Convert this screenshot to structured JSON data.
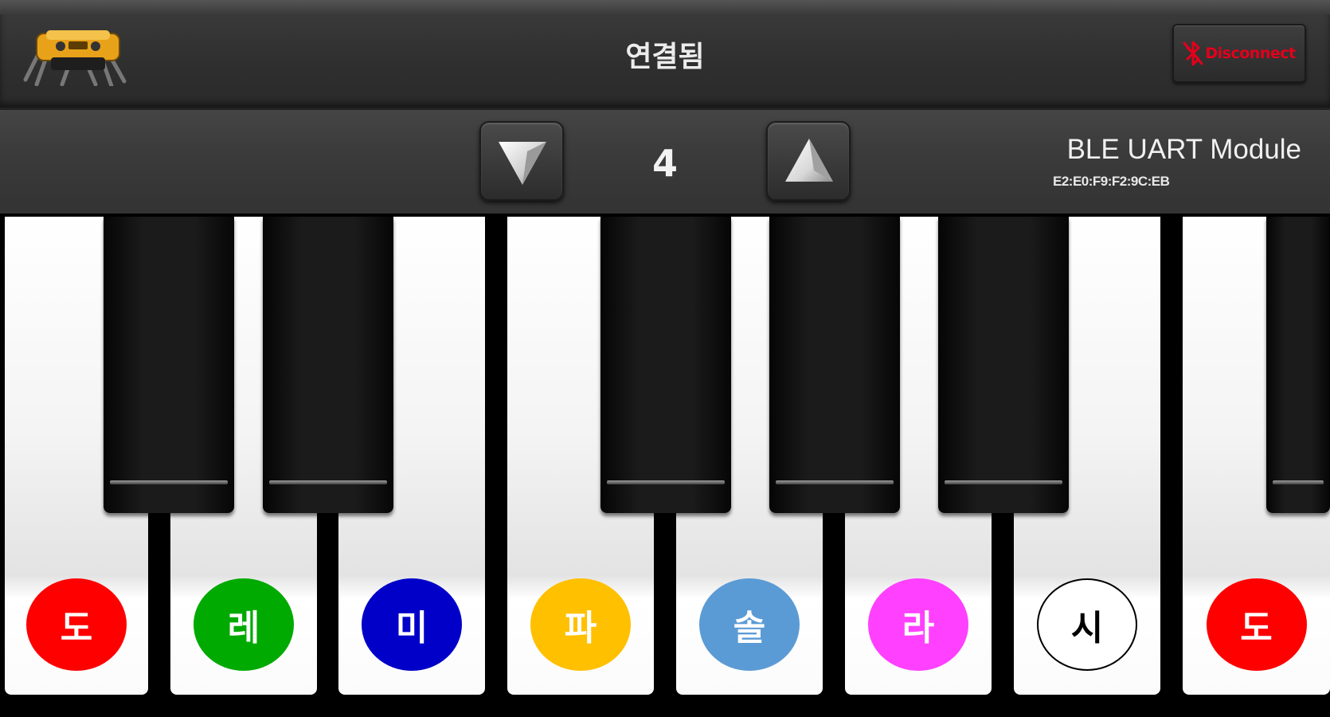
{
  "header": {
    "status": "연결됨",
    "disconnect_label": "Disconnect",
    "icons": {
      "logo": "robot-logo",
      "bluetooth": "bluetooth-off-icon"
    }
  },
  "controls": {
    "octave_value": "4",
    "down_icon": "triangle-down-icon",
    "up_icon": "triangle-up-icon"
  },
  "device": {
    "name": "BLE UART Module",
    "mac": "E2:E0:F9:F2:9C:EB"
  },
  "piano": {
    "white_keys": [
      {
        "note": "도",
        "color": "#ff0000"
      },
      {
        "note": "레",
        "color": "#00aa00"
      },
      {
        "note": "미",
        "color": "#0000c8"
      },
      {
        "note": "파",
        "color": "#ffc000"
      },
      {
        "note": "솔",
        "color": "#5b9bd5"
      },
      {
        "note": "라",
        "color": "#ff40ff"
      },
      {
        "note": "시",
        "color": "#ffffff"
      },
      {
        "note": "도",
        "color": "#ff0000"
      }
    ],
    "black_key_count": 6
  },
  "colors": {
    "header_bg": "#333333",
    "disconnect_red": "#e3001b"
  }
}
